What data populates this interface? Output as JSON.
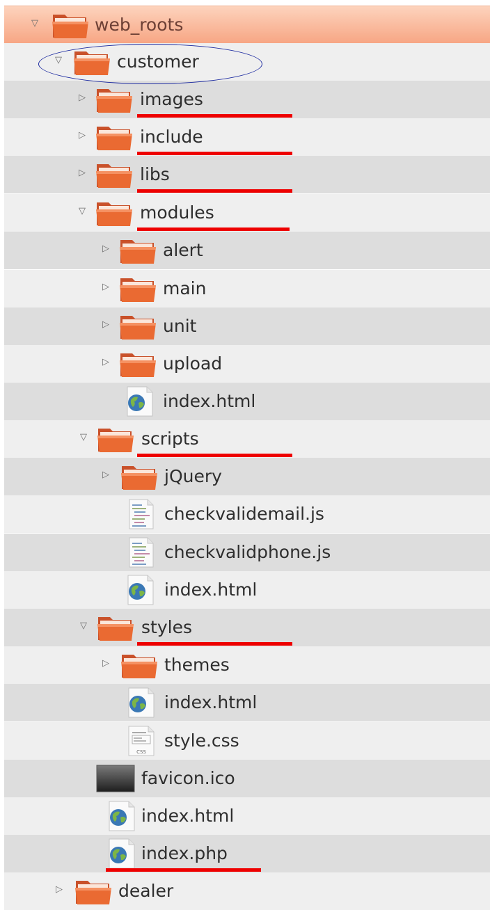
{
  "tree": {
    "rows": [
      {
        "label": "web_roots",
        "icon": "folder-icon",
        "toggle": "expanded"
      },
      {
        "label": "customer",
        "icon": "folder-icon",
        "toggle": "expanded"
      },
      {
        "label": "images",
        "icon": "folder-icon",
        "toggle": "collapsed"
      },
      {
        "label": "include",
        "icon": "folder-icon",
        "toggle": "collapsed"
      },
      {
        "label": "libs",
        "icon": "folder-icon",
        "toggle": "collapsed"
      },
      {
        "label": "modules",
        "icon": "folder-icon",
        "toggle": "expanded"
      },
      {
        "label": "alert",
        "icon": "folder-icon",
        "toggle": "collapsed"
      },
      {
        "label": "main",
        "icon": "folder-icon",
        "toggle": "collapsed"
      },
      {
        "label": "unit",
        "icon": "folder-icon",
        "toggle": "collapsed"
      },
      {
        "label": "upload",
        "icon": "folder-icon",
        "toggle": "collapsed"
      },
      {
        "label": "index.html",
        "icon": "html-file-icon",
        "toggle": "none"
      },
      {
        "label": "scripts",
        "icon": "folder-icon",
        "toggle": "expanded"
      },
      {
        "label": "jQuery",
        "icon": "folder-icon",
        "toggle": "collapsed"
      },
      {
        "label": "checkvalidemail.js",
        "icon": "js-file-icon",
        "toggle": "none"
      },
      {
        "label": "checkvalidphone.js",
        "icon": "js-file-icon",
        "toggle": "none"
      },
      {
        "label": "index.html",
        "icon": "html-file-icon",
        "toggle": "none"
      },
      {
        "label": "styles",
        "icon": "folder-icon",
        "toggle": "expanded"
      },
      {
        "label": "themes",
        "icon": "folder-icon",
        "toggle": "collapsed"
      },
      {
        "label": "index.html",
        "icon": "html-file-icon",
        "toggle": "none"
      },
      {
        "label": "style.css",
        "icon": "css-file-icon",
        "toggle": "none"
      },
      {
        "label": "favicon.ico",
        "icon": "ico-file-icon",
        "toggle": "none"
      },
      {
        "label": "index.html",
        "icon": "html-file-icon",
        "toggle": "none"
      },
      {
        "label": "index.php",
        "icon": "php-file-icon",
        "toggle": "none"
      },
      {
        "label": "dealer",
        "icon": "folder-icon",
        "toggle": "collapsed"
      }
    ],
    "selected_row": "web_roots",
    "highlight_circle": "customer",
    "underlined": [
      "images",
      "include",
      "libs",
      "modules",
      "scripts",
      "styles",
      "index.php"
    ]
  },
  "colors": {
    "underline": "#ee0000",
    "circle": "#1c2aa0",
    "selection": "#f7a684",
    "folder": "#e8662c"
  },
  "toggle_glyphs": {
    "expanded": "▽",
    "collapsed": "▷",
    "none": ""
  }
}
